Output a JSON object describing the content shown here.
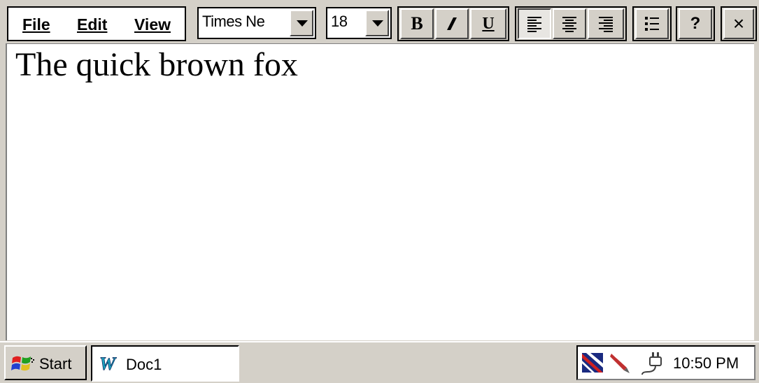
{
  "menu": {
    "file": "File",
    "edit": "Edit",
    "view": "View"
  },
  "toolbar": {
    "font_name": "Times Ne",
    "font_size": "18",
    "bold_label": "B",
    "italic_icon": "italic-icon",
    "underline_label": "U",
    "align_left_icon": "align-left-icon",
    "align_center_icon": "align-center-icon",
    "align_right_icon": "align-right-icon",
    "bullets_icon": "bullet-list-icon",
    "help_label": "?",
    "close_label": "×",
    "align_left_active": true
  },
  "document": {
    "text": "The quick brown fox"
  },
  "taskbar": {
    "start_label": "Start",
    "task_label": "Doc1",
    "clock": "10:50 PM"
  },
  "colors": {
    "face": "#d4d0c8",
    "word_icon": "#1aa6c0"
  }
}
